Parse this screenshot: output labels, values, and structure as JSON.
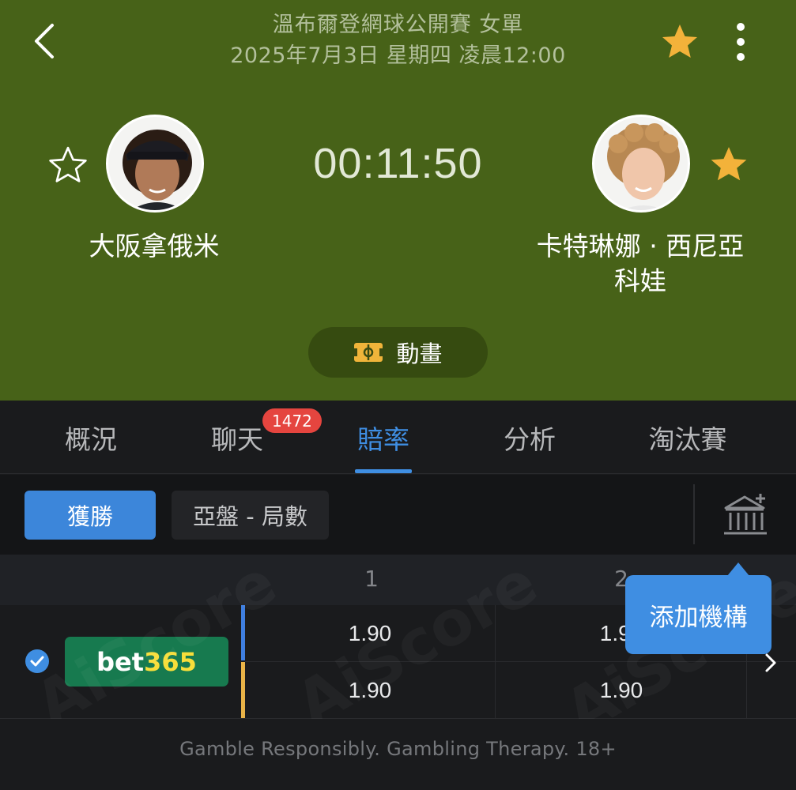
{
  "header": {
    "tournament": "溫布爾登網球公開賽 女單",
    "datetime": "2025年7月3日 星期四 凌晨12:00",
    "timer": "00:11:50"
  },
  "players": {
    "home": {
      "name": "大阪拿俄米",
      "favorited": false
    },
    "away": {
      "name_line1": "卡特琳娜 · 西尼亞",
      "name_line2": "科娃",
      "favorited": true
    }
  },
  "animation_button": {
    "label": "動畫"
  },
  "tabs": [
    {
      "label": "概況"
    },
    {
      "label": "聊天"
    },
    {
      "label": "賠率",
      "active": true
    },
    {
      "label": "分析"
    },
    {
      "label": "淘汰賽"
    }
  ],
  "chat_badge": "1472",
  "markets": {
    "selected": "獲勝",
    "other": "亞盤 - 局數"
  },
  "odds_table": {
    "columns": [
      "1",
      "2"
    ],
    "bookmaker": {
      "name_part1": "bet",
      "name_part2": "365"
    },
    "rows": [
      [
        "1.90",
        "1.90"
      ],
      [
        "1.90",
        "1.90"
      ]
    ]
  },
  "tooltip": {
    "text": "添加機構"
  },
  "watermark": "AiScore",
  "footer": {
    "text": "Gamble Responsibly. Gambling Therapy. 18+"
  },
  "colors": {
    "hero_bg": "#476218",
    "accent_blue": "#3f8ee2",
    "star_gold": "#f3b23a",
    "badge_red": "#e5453f",
    "bookmaker_green": "#177a4f"
  },
  "icons": {
    "back": "chevron-left-icon",
    "favorite": "star-icon",
    "more": "more-vertical-icon",
    "animation": "pitch-icon",
    "bank": "bank-add-icon",
    "check": "check-circle-icon",
    "row_arrow": "chevron-right-icon"
  }
}
